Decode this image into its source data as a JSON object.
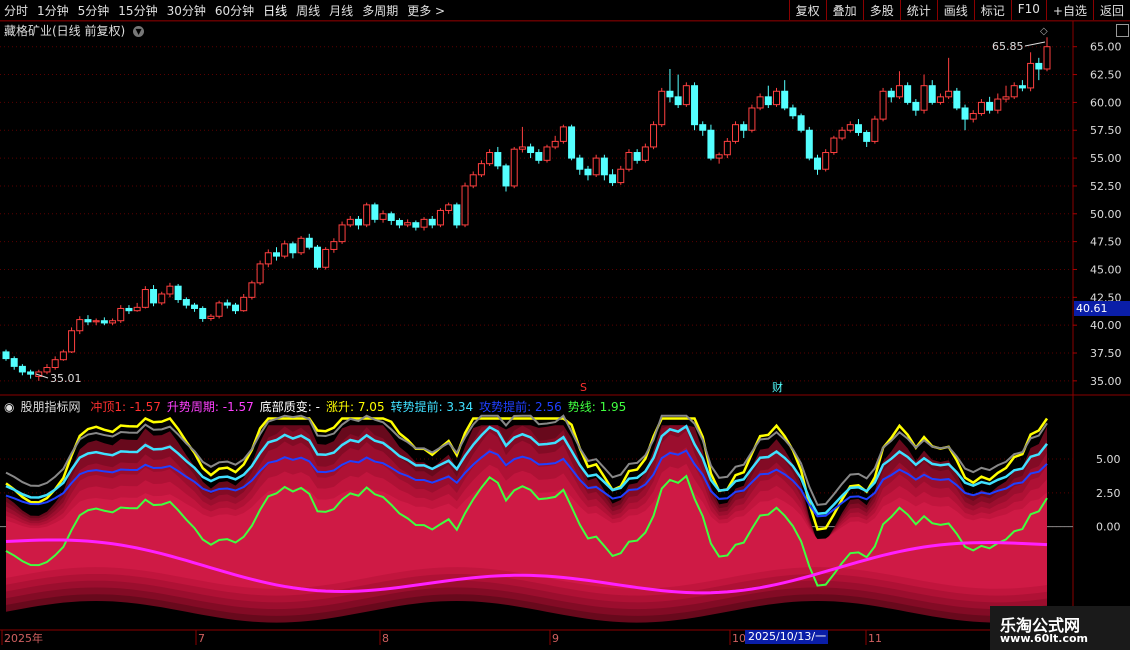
{
  "toolbar": {
    "periods": [
      "分时",
      "1分钟",
      "5分钟",
      "15分钟",
      "30分钟",
      "60分钟",
      "日线",
      "周线",
      "月线",
      "多周期",
      "更多 >"
    ],
    "active_period": "日线",
    "actions": [
      "复权",
      "叠加",
      "多股",
      "统计",
      "画线",
      "F10",
      "+自选",
      "返回"
    ],
    "mark": "标记"
  },
  "chart_title": "藏格矿业(日线 前复权)",
  "price_axis": [
    "65.00",
    "62.50",
    "60.00",
    "57.50",
    "55.00",
    "52.50",
    "50.00",
    "47.50",
    "45.00",
    "42.50",
    "40.00",
    "37.50",
    "35.00"
  ],
  "current_price": "40.61",
  "high_label": "65.85",
  "low_label": "35.01",
  "event_markers": {
    "s": "S",
    "cai": "财"
  },
  "indicator": {
    "name": "股朋指标网",
    "items": [
      {
        "text": "冲顶1: -1.57",
        "color": "#ff3030"
      },
      {
        "text": "升势周期: -1.57",
        "color": "#ff40ff"
      },
      {
        "text": "底部质变: -",
        "color": "#ffffff"
      },
      {
        "text": "涨升: 7.05",
        "color": "#ffff00"
      },
      {
        "text": "转势提前: 3.34",
        "color": "#40e0ff"
      },
      {
        "text": "攻势提前: 2.56",
        "color": "#2040ff"
      },
      {
        "text": "势线: 1.95",
        "color": "#40ff40"
      }
    ],
    "axis": [
      "5.00",
      "2.50",
      "0.00"
    ]
  },
  "date_axis": [
    {
      "label": "2025年"
    },
    {
      "label": "7"
    },
    {
      "label": "8"
    },
    {
      "label": "9"
    },
    {
      "label": "10"
    },
    {
      "label": "11"
    }
  ],
  "cursor_date": "2025/10/13/一",
  "watermark": {
    "line1": "乐淘公式网",
    "line2": "www.60lt.com"
  },
  "chart_data": {
    "type": "candlestick",
    "ylim": [
      34,
      66.5
    ],
    "candles": [
      [
        37.6,
        37.0,
        37.8,
        36.8
      ],
      [
        37.0,
        36.3,
        37.2,
        36.0
      ],
      [
        36.3,
        35.8,
        36.5,
        35.5
      ],
      [
        35.8,
        35.6,
        36.0,
        35.2
      ],
      [
        35.4,
        35.8,
        36.0,
        35.0
      ],
      [
        35.8,
        36.2,
        36.5,
        35.6
      ],
      [
        36.2,
        36.9,
        37.2,
        36.0
      ],
      [
        36.9,
        37.6,
        37.8,
        36.8
      ],
      [
        37.6,
        39.5,
        39.8,
        37.5
      ],
      [
        39.5,
        40.5,
        40.8,
        39.2
      ],
      [
        40.5,
        40.3,
        40.9,
        40.0
      ],
      [
        40.3,
        40.4,
        40.6,
        40.0
      ],
      [
        40.4,
        40.2,
        40.7,
        40.0
      ],
      [
        40.2,
        40.4,
        40.6,
        40.0
      ],
      [
        40.4,
        41.5,
        41.8,
        40.2
      ],
      [
        41.5,
        41.3,
        41.8,
        41.0
      ],
      [
        41.3,
        41.6,
        42.0,
        41.2
      ],
      [
        41.6,
        43.2,
        43.5,
        41.5
      ],
      [
        43.2,
        42.0,
        43.6,
        41.7
      ],
      [
        42.0,
        42.8,
        43.0,
        41.8
      ],
      [
        42.8,
        43.5,
        43.8,
        42.5
      ],
      [
        43.5,
        42.3,
        43.7,
        42.0
      ],
      [
        42.3,
        41.8,
        42.5,
        41.5
      ],
      [
        41.8,
        41.5,
        42.0,
        41.2
      ],
      [
        41.5,
        40.6,
        41.7,
        40.3
      ],
      [
        40.6,
        40.8,
        41.0,
        40.4
      ],
      [
        40.8,
        42.0,
        42.2,
        40.6
      ],
      [
        42.0,
        41.8,
        42.3,
        41.5
      ],
      [
        41.8,
        41.3,
        42.0,
        41.0
      ],
      [
        41.3,
        42.5,
        42.8,
        41.2
      ],
      [
        42.5,
        43.8,
        44.0,
        42.3
      ],
      [
        43.8,
        45.5,
        45.8,
        43.6
      ],
      [
        45.5,
        46.5,
        46.8,
        45.2
      ],
      [
        46.5,
        46.2,
        47.0,
        45.8
      ],
      [
        46.2,
        47.3,
        47.6,
        46.0
      ],
      [
        47.3,
        46.5,
        47.5,
        46.0
      ],
      [
        46.5,
        47.8,
        48.0,
        46.3
      ],
      [
        47.8,
        47.0,
        48.2,
        46.8
      ],
      [
        47.0,
        45.2,
        47.2,
        45.0
      ],
      [
        45.2,
        46.8,
        47.0,
        45.0
      ],
      [
        46.8,
        47.5,
        47.8,
        46.5
      ],
      [
        47.5,
        49.0,
        49.3,
        47.3
      ],
      [
        49.0,
        49.5,
        49.8,
        48.8
      ],
      [
        49.5,
        49.0,
        49.8,
        48.6
      ],
      [
        49.0,
        50.8,
        51.0,
        48.8
      ],
      [
        50.8,
        49.5,
        51.0,
        49.2
      ],
      [
        49.5,
        50.0,
        50.3,
        49.2
      ],
      [
        50.0,
        49.4,
        50.2,
        49.0
      ],
      [
        49.4,
        49.0,
        49.6,
        48.7
      ],
      [
        49.0,
        49.2,
        49.5,
        48.8
      ],
      [
        49.2,
        48.8,
        49.4,
        48.5
      ],
      [
        48.8,
        49.5,
        49.7,
        48.5
      ],
      [
        49.5,
        49.0,
        49.8,
        48.7
      ],
      [
        49.0,
        50.3,
        50.5,
        48.8
      ],
      [
        50.3,
        50.8,
        51.0,
        50.0
      ],
      [
        50.8,
        49.0,
        51.0,
        48.7
      ],
      [
        49.0,
        52.5,
        52.8,
        48.8
      ],
      [
        52.5,
        53.5,
        53.8,
        52.3
      ],
      [
        53.5,
        54.5,
        54.8,
        53.3
      ],
      [
        54.5,
        55.5,
        55.8,
        54.3
      ],
      [
        55.5,
        54.3,
        56.0,
        54.0
      ],
      [
        54.3,
        52.5,
        54.5,
        52.0
      ],
      [
        52.5,
        55.8,
        56.0,
        52.3
      ],
      [
        55.8,
        56.0,
        57.8,
        55.5
      ],
      [
        56.0,
        55.5,
        56.3,
        55.0
      ],
      [
        55.5,
        54.8,
        55.8,
        54.5
      ],
      [
        54.8,
        56.0,
        56.2,
        54.6
      ],
      [
        56.0,
        56.5,
        57.0,
        55.8
      ],
      [
        56.5,
        57.8,
        58.0,
        56.3
      ],
      [
        57.8,
        55.0,
        58.0,
        54.8
      ],
      [
        55.0,
        54.0,
        55.3,
        53.5
      ],
      [
        54.0,
        53.5,
        54.3,
        53.0
      ],
      [
        53.5,
        55.0,
        55.3,
        53.3
      ],
      [
        55.0,
        53.5,
        55.3,
        53.0
      ],
      [
        53.5,
        52.8,
        54.0,
        52.5
      ],
      [
        52.8,
        54.0,
        54.3,
        52.6
      ],
      [
        54.0,
        55.5,
        55.8,
        53.8
      ],
      [
        55.5,
        54.8,
        55.8,
        54.5
      ],
      [
        54.8,
        56.0,
        56.3,
        54.6
      ],
      [
        56.0,
        58.0,
        58.3,
        55.8
      ],
      [
        58.0,
        61.0,
        61.3,
        57.8
      ],
      [
        61.0,
        60.5,
        63.0,
        60.0
      ],
      [
        60.5,
        59.8,
        62.5,
        59.5
      ],
      [
        59.8,
        61.5,
        61.8,
        59.6
      ],
      [
        61.5,
        58.0,
        61.8,
        57.5
      ],
      [
        58.0,
        57.5,
        58.3,
        57.0
      ],
      [
        57.5,
        55.0,
        58.0,
        54.8
      ],
      [
        55.0,
        55.3,
        55.5,
        54.5
      ],
      [
        55.3,
        56.5,
        56.8,
        55.0
      ],
      [
        56.5,
        58.0,
        58.3,
        56.3
      ],
      [
        58.0,
        57.5,
        58.3,
        56.8
      ],
      [
        57.5,
        59.5,
        59.8,
        57.3
      ],
      [
        59.5,
        60.5,
        60.8,
        59.3
      ],
      [
        60.5,
        59.8,
        61.5,
        59.5
      ],
      [
        59.8,
        61.0,
        61.3,
        59.6
      ],
      [
        61.0,
        59.5,
        62.0,
        59.3
      ],
      [
        59.5,
        58.8,
        59.8,
        58.5
      ],
      [
        58.8,
        57.5,
        59.0,
        57.3
      ],
      [
        57.5,
        55.0,
        57.8,
        54.8
      ],
      [
        55.0,
        54.0,
        55.3,
        53.5
      ],
      [
        54.0,
        55.5,
        55.8,
        53.8
      ],
      [
        55.5,
        56.8,
        57.0,
        55.3
      ],
      [
        56.8,
        57.5,
        57.8,
        56.6
      ],
      [
        57.5,
        58.0,
        58.3,
        57.3
      ],
      [
        58.0,
        57.3,
        58.5,
        57.0
      ],
      [
        57.3,
        56.5,
        57.5,
        56.0
      ],
      [
        56.5,
        58.5,
        58.8,
        56.3
      ],
      [
        58.5,
        61.0,
        61.3,
        58.3
      ],
      [
        61.0,
        60.5,
        61.3,
        60.0
      ],
      [
        60.5,
        61.5,
        62.8,
        60.3
      ],
      [
        61.5,
        60.0,
        61.8,
        59.8
      ],
      [
        60.0,
        59.3,
        60.3,
        58.8
      ],
      [
        59.3,
        61.5,
        62.5,
        59.0
      ],
      [
        61.5,
        60.0,
        62.0,
        59.8
      ],
      [
        60.0,
        60.5,
        60.8,
        59.8
      ],
      [
        60.5,
        61.0,
        64.0,
        60.3
      ],
      [
        61.0,
        59.5,
        61.3,
        59.3
      ],
      [
        59.5,
        58.5,
        59.8,
        57.5
      ],
      [
        58.5,
        59.0,
        59.3,
        58.2
      ],
      [
        59.0,
        60.0,
        60.3,
        58.8
      ],
      [
        60.0,
        59.3,
        60.5,
        59.0
      ],
      [
        59.3,
        60.3,
        60.8,
        59.0
      ],
      [
        60.3,
        60.5,
        61.5,
        60.0
      ],
      [
        60.5,
        61.5,
        61.8,
        60.3
      ],
      [
        61.5,
        61.3,
        62.0,
        61.0
      ],
      [
        61.3,
        63.5,
        64.5,
        61.0
      ],
      [
        63.5,
        63.0,
        64.0,
        62.0
      ],
      [
        63.0,
        65.0,
        65.85,
        62.8
      ]
    ],
    "indicator_range": [
      -7.5,
      9
    ]
  }
}
